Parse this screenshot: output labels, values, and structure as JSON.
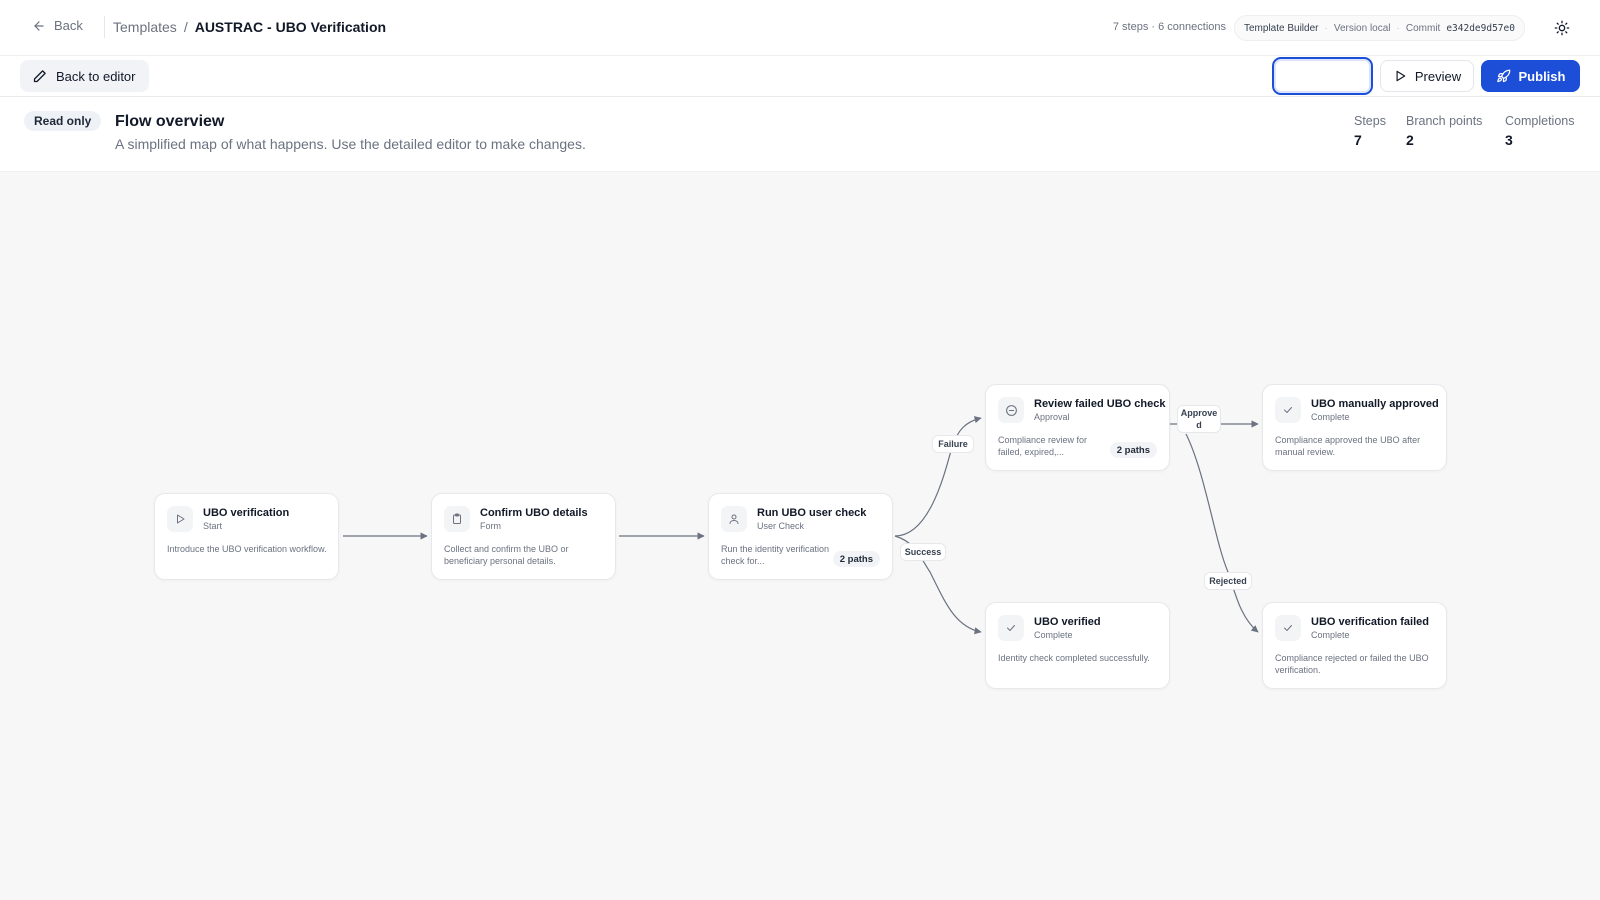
{
  "topbar": {
    "back_label": "Back",
    "breadcrumb_root": "Templates",
    "breadcrumb_separator": "/",
    "title": "AUSTRAC - UBO Verification",
    "summary": "7 steps · 6 connections",
    "app_name": "Template Builder",
    "meta_separator": "·",
    "version": "Version local",
    "commit_label": "Commit",
    "commit_hash": "e342de9d57e0"
  },
  "toolbar": {
    "back_to_editor_label": "Back to editor",
    "preview_label": "Preview",
    "publish_label": "Publish"
  },
  "overview": {
    "badge": "Read only",
    "title": "Flow overview",
    "subtitle": "A simplified map of what happens. Use the detailed editor to make changes.",
    "stats": [
      {
        "label": "Steps",
        "value": "7"
      },
      {
        "label": "Branch points",
        "value": "2"
      },
      {
        "label": "Completions",
        "value": "3"
      }
    ]
  },
  "nodes": [
    {
      "title": "UBO verification",
      "type": "Start",
      "icon": "play-icon",
      "description": "Introduce the UBO verification workflow."
    },
    {
      "title": "Confirm UBO details",
      "type": "Form",
      "icon": "clipboard-icon",
      "description": "Collect and confirm the UBO or beneficiary personal details."
    },
    {
      "title": "Run UBO user check",
      "type": "User Check",
      "icon": "user-icon",
      "description": "Run the identity verification check for...",
      "paths": "2 paths"
    },
    {
      "title": "Review failed UBO check",
      "type": "Approval",
      "icon": "approval-icon",
      "description": "Compliance review for failed, expired,...",
      "paths": "2 paths"
    },
    {
      "title": "UBO manually approved",
      "type": "Complete",
      "icon": "check-icon",
      "description": "Compliance approved the UBO after manual review."
    },
    {
      "title": "UBO verified",
      "type": "Complete",
      "icon": "check-icon",
      "description": "Identity check completed successfully."
    },
    {
      "title": "UBO verification failed",
      "type": "Complete",
      "icon": "check-icon",
      "description": "Compliance rejected or failed the UBO verification."
    }
  ],
  "edge_labels": {
    "failure": "Failure",
    "success": "Success",
    "approved": "Approve d",
    "rejected": "Rejected"
  },
  "colors": {
    "accent": "#1d4ed8",
    "edge": "#6b7280"
  }
}
